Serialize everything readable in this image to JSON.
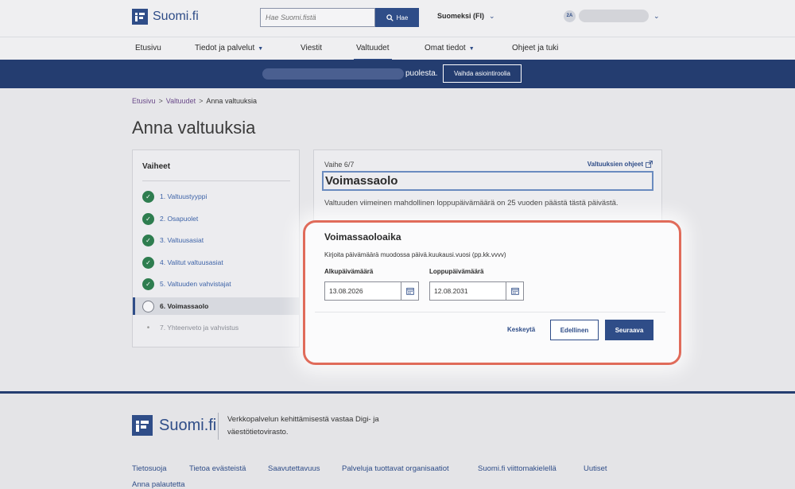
{
  "header": {
    "logo_text": "Suomi.fi",
    "search_placeholder": "Hae Suomi.fistä",
    "search_button": "Hae",
    "language": "Suomeksi (FI)",
    "user_initials": "2A"
  },
  "nav": {
    "items": [
      {
        "label": "Etusivu",
        "dropdown": false
      },
      {
        "label": "Tiedot ja palvelut",
        "dropdown": true
      },
      {
        "label": "Viestit",
        "dropdown": false
      },
      {
        "label": "Valtuudet",
        "dropdown": false,
        "active": true
      },
      {
        "label": "Omat tiedot",
        "dropdown": true
      },
      {
        "label": "Ohjeet ja tuki",
        "dropdown": false
      }
    ]
  },
  "rolebar": {
    "text": "puolesta.",
    "button": "Vaihda asiointiroolia"
  },
  "breadcrumb": {
    "items": [
      "Etusivu",
      "Valtuudet"
    ],
    "current": "Anna valtuuksia"
  },
  "page_title": "Anna valtuuksia",
  "steps": {
    "title": "Vaiheet",
    "items": [
      {
        "label": "1. Valtuustyyppi",
        "status": "done"
      },
      {
        "label": "2. Osapuolet",
        "status": "done"
      },
      {
        "label": "3. Valtuusasiat",
        "status": "done"
      },
      {
        "label": "4. Valitut valtuusasiat",
        "status": "done"
      },
      {
        "label": "5. Valtuuden vahvistajat",
        "status": "done"
      },
      {
        "label": "6. Voimassaolo",
        "status": "current"
      },
      {
        "label": "7. Yhteenveto ja vahvistus",
        "status": "todo"
      }
    ]
  },
  "card": {
    "phase": "Vaihe 6/7",
    "help_link": "Valtuuksien ohjeet",
    "heading": "Voimassaolo",
    "info": "Valtuuden viimeinen mahdollinen loppupäivämäärä on 25 vuoden päästä tästä päivästä."
  },
  "validity": {
    "title": "Voimassaoloaika",
    "hint": "Kirjoita päivämäärä muodossa päivä.kuukausi.vuosi (pp.kk.vvvv)",
    "start_label": "Alkupäivämäärä",
    "start_value": "13.08.2026",
    "end_label": "Loppupäivämäärä",
    "end_value": "12.08.2031",
    "cancel": "Keskeytä",
    "previous": "Edellinen",
    "next": "Seuraava"
  },
  "footer": {
    "logo_text": "Suomi.fi",
    "description": "Verkkopalvelun kehittämisestä vastaa Digi- ja väestötietovirasto.",
    "links": [
      "Tietosuoja",
      "Tietoa evästeistä",
      "Saavutettavuus",
      "Palveluja tuottavat organisaatiot",
      "Suomi.fi viittomakielellä",
      "Uutiset",
      "Anna palautetta"
    ]
  },
  "colors": {
    "brand": "#2f4d88",
    "rolebar": "#243d70",
    "success": "#2e7d4f",
    "highlight": "#e06b5a"
  }
}
